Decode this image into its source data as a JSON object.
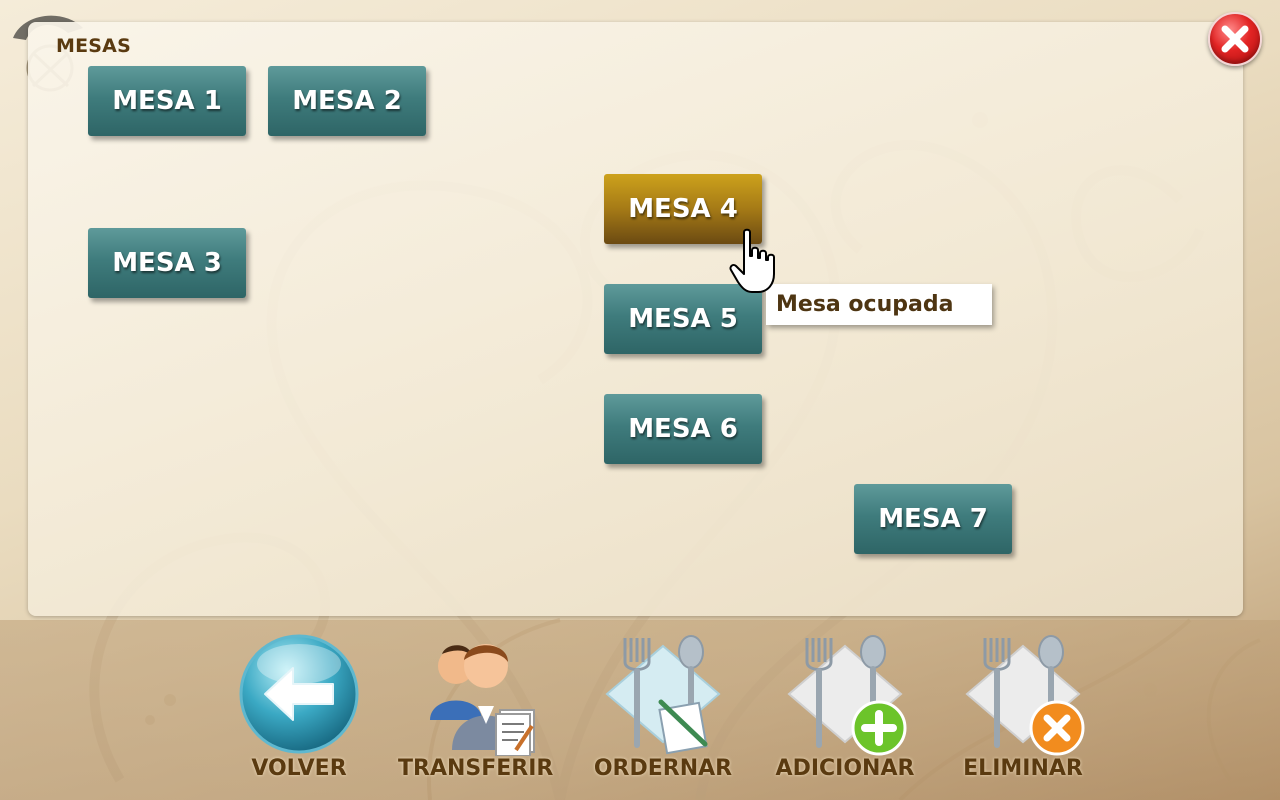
{
  "header": {
    "title": "MESAS"
  },
  "tables": [
    {
      "label": "MESA 1",
      "status": "free"
    },
    {
      "label": "MESA 2",
      "status": "free"
    },
    {
      "label": "MESA 3",
      "status": "free"
    },
    {
      "label": "MESA 4",
      "status": "occupied"
    },
    {
      "label": "MESA 5",
      "status": "free"
    },
    {
      "label": "MESA 6",
      "status": "free"
    },
    {
      "label": "MESA 7",
      "status": "free"
    }
  ],
  "tooltip": {
    "text": "Mesa ocupada"
  },
  "toolbar": {
    "volver": "VOLVER",
    "transferir": "TRANSFERIR",
    "ordernar": "ORDERNAR",
    "adicionar": "ADICIONAR",
    "eliminar": "ELIMINAR"
  },
  "icons": {
    "close": "close-icon",
    "back": "back-arrow-icon",
    "transfer": "transfer-people-icon",
    "order": "order-cutlery-icon",
    "add": "add-cutlery-icon",
    "delete": "delete-cutlery-icon",
    "cursor": "hand-pointer-icon"
  },
  "colors": {
    "table_free": "#3f7c7d",
    "table_occupied": "#a57a16",
    "label_text": "#5a3a10",
    "close": "#e22424"
  }
}
